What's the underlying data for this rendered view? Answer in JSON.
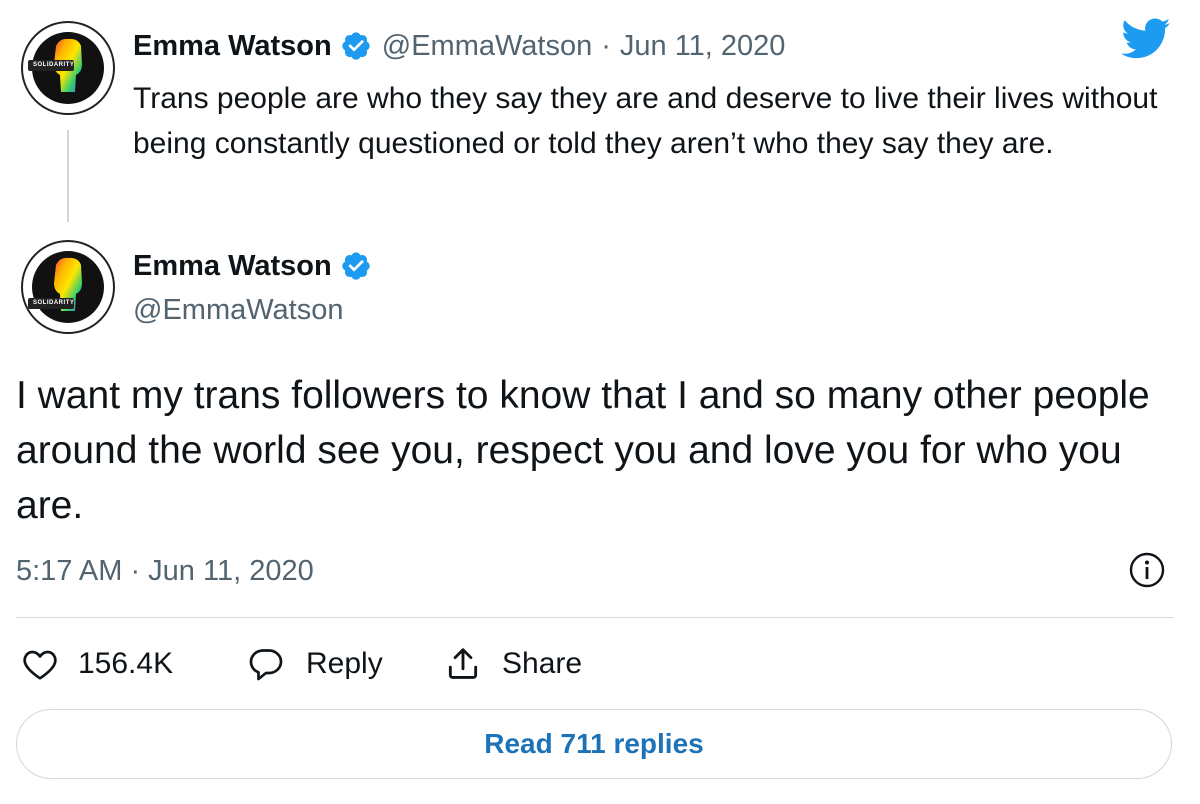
{
  "parent_tweet": {
    "author_name": "Emma Watson",
    "handle": "@EmmaWatson",
    "separator": "·",
    "date": "Jun 11, 2020",
    "text": "Trans people are who they say they are and deserve to live their lives without being constantly questioned or told they aren’t who they say they are."
  },
  "main_tweet": {
    "author_name": "Emma Watson",
    "handle": "@EmmaWatson",
    "text": "I want my trans followers to know that I and so many other people around the world see you, respect you and love you for who you are.",
    "timestamp": "5:17 AM · Jun 11, 2020"
  },
  "avatar": {
    "badge_text": "SOLIDARITY",
    "icon": "raised-fist-rainbow"
  },
  "actions": {
    "like_count": "156.4K",
    "reply_label": "Reply",
    "share_label": "Share"
  },
  "read_replies_label": "Read 711 replies",
  "colors": {
    "brand_blue": "#1d9bf0",
    "link_blue": "#1d73b8",
    "muted_text": "#536471",
    "text": "#0f1419",
    "border": "#cfd9de"
  }
}
